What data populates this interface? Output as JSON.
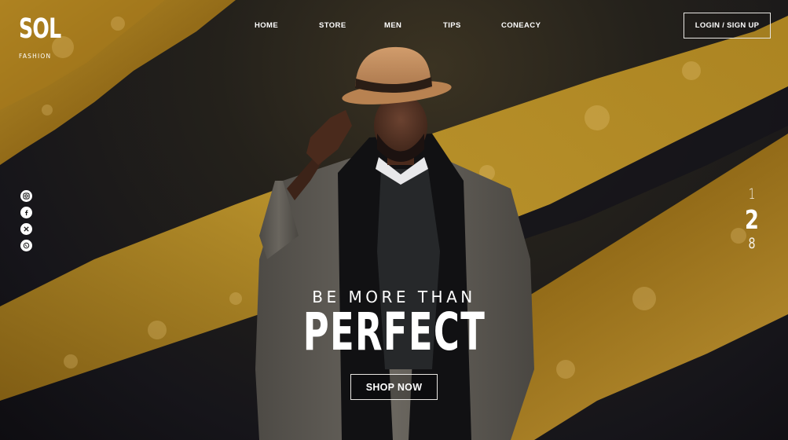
{
  "brand": {
    "name": "SOL",
    "sub": "FASHION"
  },
  "nav": {
    "items": [
      {
        "label": "HOME"
      },
      {
        "label": "STORE"
      },
      {
        "label": "MEN"
      },
      {
        "label": "TIPS"
      },
      {
        "label": "CONEACY"
      }
    ],
    "login_label": "LOGIN / SIGN UP"
  },
  "social": {
    "icons": [
      "instagram-icon",
      "facebook-icon",
      "x-icon",
      "whatsapp-icon"
    ]
  },
  "pager": {
    "pages": [
      "1",
      "2",
      "8"
    ],
    "active": "2"
  },
  "hero": {
    "tagline": "BE MORE THAN",
    "headline": "PERFECT",
    "cta_label": "SHOP NOW"
  },
  "colors": {
    "gold": "#b58a1e",
    "gold_dark": "#7a5a12",
    "background": "#1a1816",
    "hat": "#c08a5a",
    "jacket": "#5f5c56"
  }
}
